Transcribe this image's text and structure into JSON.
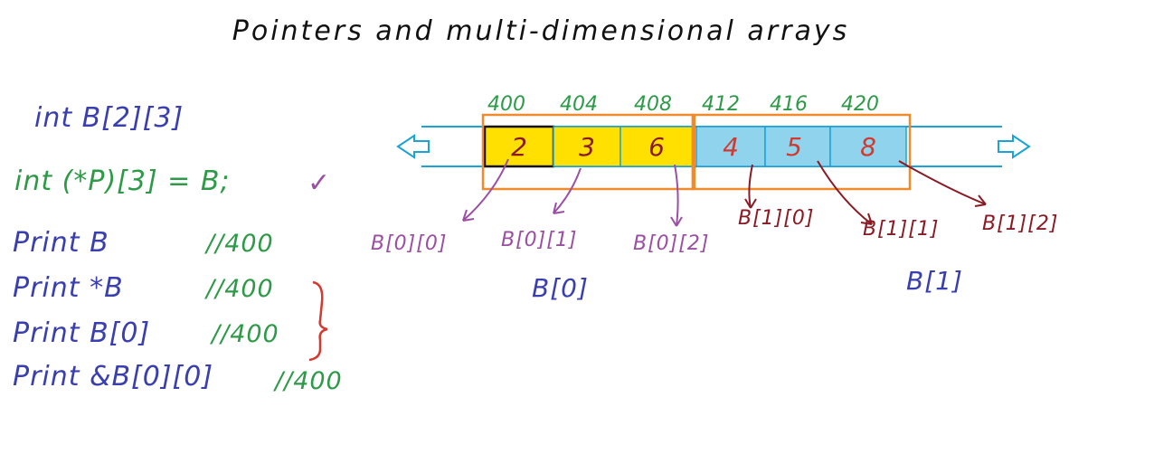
{
  "title": "Pointers and multi-dimensional arrays",
  "colors": {
    "blue_ink": "#3a3fb0",
    "green_ink": "#2e9a48",
    "purple_ink": "#9b4fa3",
    "maroon_ink": "#8a1a24",
    "red_ink": "#d23a2f",
    "orange_box": "#f08a2c",
    "cyan_line": "#1aa3d6",
    "yellow_cell": "#ffe000",
    "sky_cell": "#8fd3ec"
  },
  "code": {
    "declaration": "int  B[2][3]",
    "pointer_decl": "int (*P)[3] = B;",
    "checkmark": "✓",
    "prints": [
      {
        "stmt": "Print  B",
        "comment": "//400"
      },
      {
        "stmt": "Print  *B",
        "comment": "//400"
      },
      {
        "stmt": "Print  B[0]",
        "comment": "//400"
      },
      {
        "stmt": "Print  &B[0][0]",
        "comment": "//400"
      }
    ]
  },
  "memory": {
    "addresses": [
      "400",
      "404",
      "408",
      "412",
      "416",
      "420"
    ],
    "cells": [
      "2",
      "3",
      "6",
      "4",
      "5",
      "8"
    ]
  },
  "labels": {
    "row0": [
      "B[0][0]",
      "B[0][1]",
      "B[0][2]"
    ],
    "row1": [
      "B[1][0]",
      "B[1][1]",
      "B[1][2]"
    ],
    "group0": "B[0]",
    "group1": "B[1]"
  }
}
